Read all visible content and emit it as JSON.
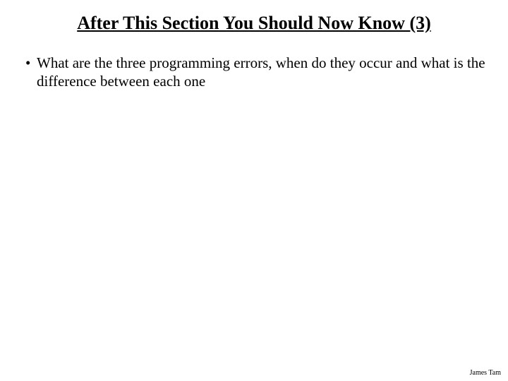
{
  "slide": {
    "title": "After This Section You Should Now Know (3)",
    "bullets": [
      "What are the three programming errors, when do they occur and what is the difference between each one"
    ],
    "footer": "James Tam"
  }
}
